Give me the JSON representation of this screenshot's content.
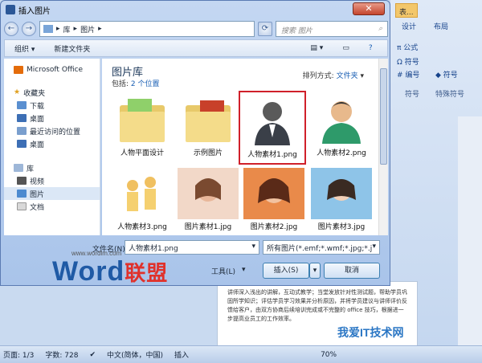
{
  "window": {
    "title": "插入图片",
    "close": "✕"
  },
  "ribbon": {
    "tabs": [
      "表..."
    ],
    "subtabs": [
      "设计",
      "布局"
    ],
    "formula": "公式",
    "symbols": {
      "a": "符号",
      "b": "编号",
      "c": "符号"
    },
    "group_labels": [
      "符号",
      "特殊符号"
    ]
  },
  "nav": {
    "back": "←",
    "forward": "→",
    "breadcrumb": [
      "库",
      "图片"
    ],
    "search_placeholder": "搜索 图片"
  },
  "toolbar": {
    "organize": "组织",
    "new_folder": "新建文件夹"
  },
  "left_pane": {
    "items": [
      {
        "label": "Microsoft Office",
        "head": true
      },
      {
        "label": "收藏夹",
        "head": true
      },
      {
        "label": "下载"
      },
      {
        "label": "桌面"
      },
      {
        "label": "最近访问的位置"
      },
      {
        "label": "桌面"
      },
      {
        "label": "库",
        "head": true
      },
      {
        "label": "视频"
      },
      {
        "label": "图片",
        "selected": true
      },
      {
        "label": "文档"
      }
    ]
  },
  "library": {
    "title": "图片库",
    "includes_prefix": "包括:",
    "includes_link": "2 个位置",
    "arrange_label": "排列方式:",
    "arrange_value": "文件夹"
  },
  "files": [
    {
      "name": "人物平面设计",
      "type": "folder"
    },
    {
      "name": "示例图片",
      "type": "folder"
    },
    {
      "name": "人物素材1.png",
      "type": "person-dark",
      "selected": true
    },
    {
      "name": "人物素材2.png",
      "type": "person-green"
    },
    {
      "name": "人物素材3.png",
      "type": "people-small"
    },
    {
      "name": "图片素材1.jpg",
      "type": "photo"
    },
    {
      "name": "图片素材2.jpg",
      "type": "photo"
    },
    {
      "name": "图片素材3.jpg",
      "type": "photo"
    }
  ],
  "bottom": {
    "filename_label": "文件名(N):",
    "filename_value": "人物素材1.png",
    "filetype_value": "所有图片(*.emf;*.wmf;*.jpg;*.j",
    "tools": "工具(L)",
    "insert": "插入(S)",
    "cancel": "取消"
  },
  "watermark": {
    "word": "Word",
    "cn": "联盟",
    "url": "www.wordlm.com",
    "bottom": "我爱IT技术网"
  },
  "doc_text": "讲师深入浅出的讲解，互动式教学；当堂发放针对性测试题，帮助学员巩固所学知识；评估学员学习效果并分析原因，并将学员建议与讲师评价反馈给客户，由双方协商后续培训完成或不完整的 office 技巧，根据进一步提高业员工的工作效率。",
  "status": {
    "page": "页面: 1/3",
    "words": "字数: 728",
    "lang": "中文(简体，中国)",
    "mode": "插入",
    "zoom": "70%"
  }
}
